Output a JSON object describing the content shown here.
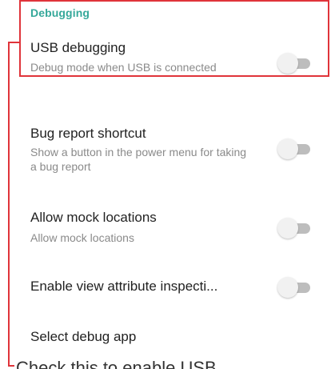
{
  "section": {
    "header": "Debugging"
  },
  "settings": [
    {
      "title": "USB debugging",
      "summary": "Debug mode when USB is connected",
      "enabled": false
    },
    {
      "title": "Bug report shortcut",
      "summary": "Show a button in the power menu for taking a bug report",
      "enabled": false
    },
    {
      "title": "Allow mock locations",
      "summary": "Allow mock locations",
      "enabled": false
    },
    {
      "title": "Enable view attribute inspecti...",
      "summary": "",
      "enabled": false
    },
    {
      "title": "Select debug app",
      "summary": ""
    }
  ],
  "annotation": {
    "text": "Check this to enable USB",
    "color": "#e0343a"
  },
  "colors": {
    "accent": "#35a89a",
    "switch_track_off": "#bdbdbd",
    "switch_thumb_off": "#f1f1f1"
  }
}
